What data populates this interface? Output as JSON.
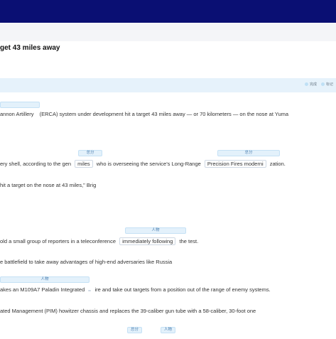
{
  "header": {
    "title": "get 43 miles away"
  },
  "toolbar": {
    "legend": [
      {
        "label": "完成"
      },
      {
        "label": "标记"
      }
    ]
  },
  "tags": {
    "t0": "",
    "t1": "总分",
    "t2": "总分",
    "t3": "人物",
    "t4": "人物",
    "t5": "总分",
    "t6": "人物"
  },
  "content": {
    "l1_a": "annon Artillery",
    "l1_b": "(ERCA) system under development hit a target 43 miles away — or 70 kilometers — on the nose at Yuma",
    "l2_a": "ery shell, according to the gen",
    "l2_box1": "miles",
    "l2_b": "who is overseeing the service’s Long-Range",
    "l2_box2": "Precision Fires moderni",
    "l2_c": "zation.",
    "l3": "hit a target on the nose at 43 miles,\"   Brig",
    "l4_a": "old a small group of reporters in a teleconference",
    "l4_box": "immediately following",
    "l4_b": "the test.",
    "l5": "e battlefield to take away advantages of high-end adversaries like Russia",
    "l6_a": "akes an M109A7 Paladin Integrated",
    "l6_b": "ire and take out targets from a position out of the range of enemy systems.",
    "l7": "ated Management (PIM) howitzer chassis and replaces the 39-caliber gun tube with a 58-caliber, 30-foot one"
  }
}
